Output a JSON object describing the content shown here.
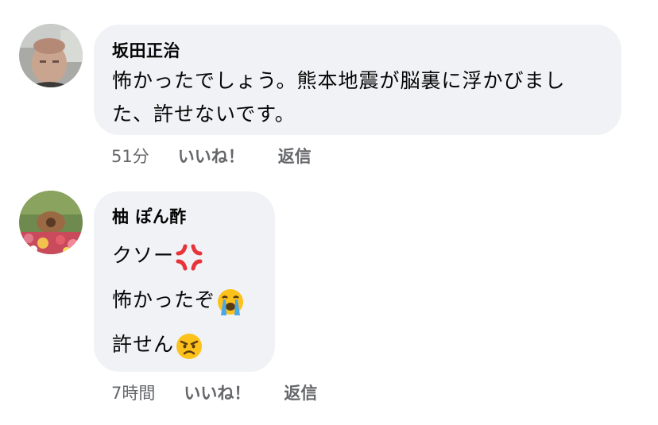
{
  "comments": [
    {
      "author": "坂田正治",
      "lines": [
        "怖かったでしょう。熊本地震が脳裏に浮かびまし",
        "た、許せないです。"
      ],
      "time": "51分",
      "like_label": "いいね！",
      "reply_label": "返信"
    },
    {
      "author": "柚 ぽん酢",
      "lines": [
        "クソー",
        "怖かったぞ",
        "許せん"
      ],
      "emojis": [
        "anger-symbol",
        "loudly-crying-face",
        "angry-face"
      ],
      "time": "7時間",
      "like_label": "いいね！",
      "reply_label": "返信"
    }
  ]
}
